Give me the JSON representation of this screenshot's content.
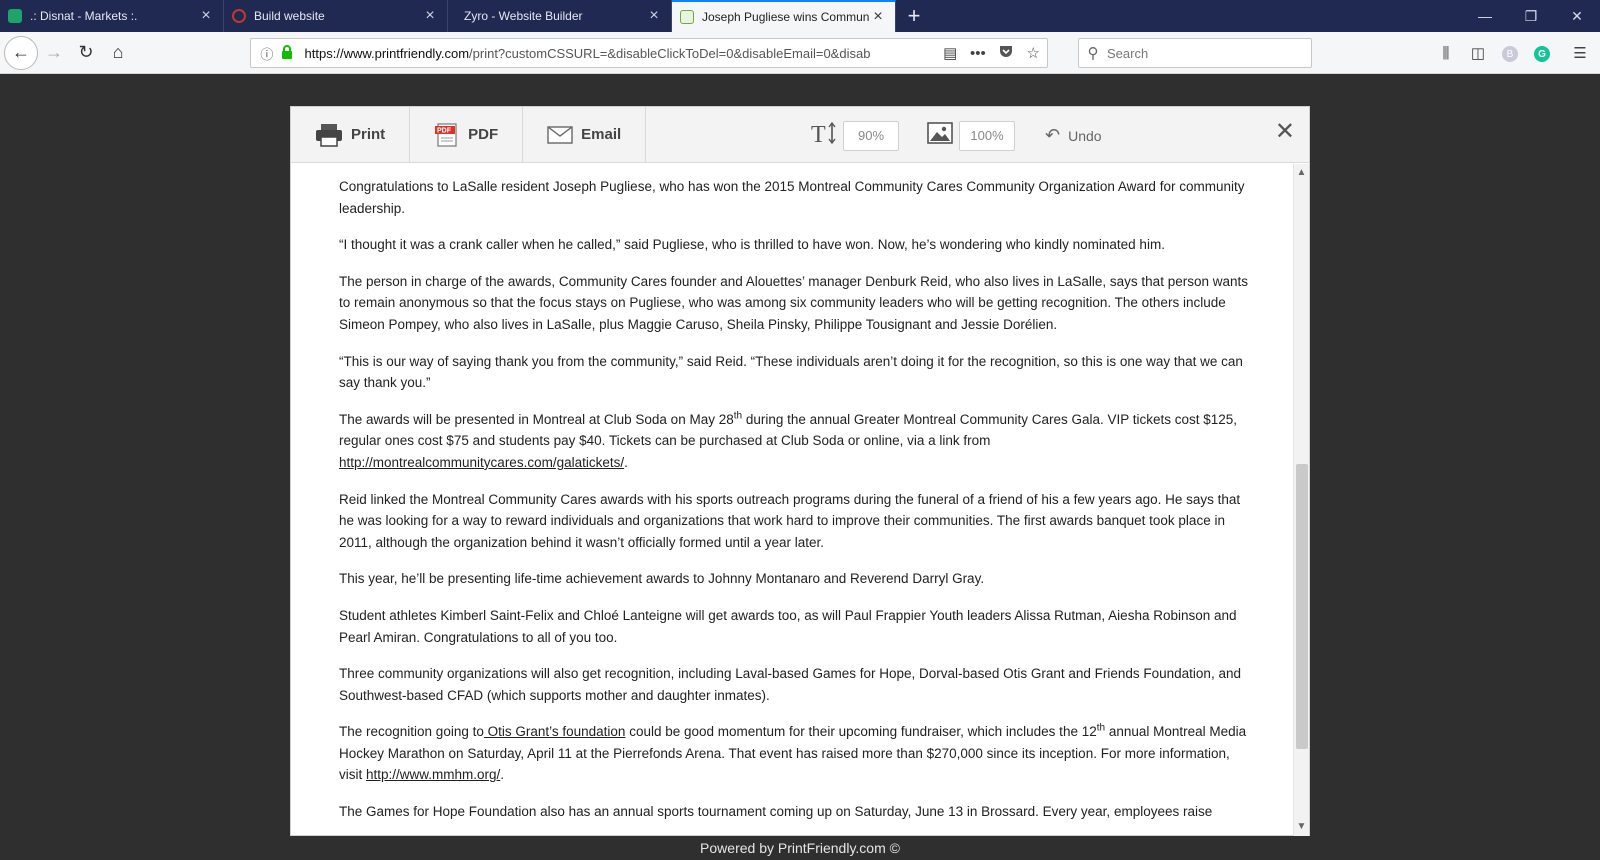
{
  "browser": {
    "tabs": [
      {
        "title": ".: Disnat - Markets :.",
        "favicon": "disnat-icon",
        "active": false
      },
      {
        "title": "Build website",
        "favicon": "zyro-icon",
        "active": false
      },
      {
        "title": "Zyro - Website Builder",
        "favicon": "blank-icon",
        "active": false
      },
      {
        "title": "Joseph Pugliese wins Commun",
        "favicon": "printfriendly-icon",
        "active": true
      }
    ],
    "new_tab_symbol": "+",
    "window_controls": [
      "—",
      "❐",
      "✕"
    ],
    "url_domain": "https://www.printfriendly.com",
    "url_rest": "/print?customCSSURL=&disableClickToDel=0&disableEmail=0&disab",
    "search_placeholder": "Search",
    "profile_letter": "B",
    "grammarly_letter": "G"
  },
  "toolbar": {
    "print_label": "Print",
    "pdf_label": "PDF",
    "email_label": "Email",
    "text_size": "90%",
    "image_size": "100%",
    "undo_label": "Undo",
    "close_symbol": "✕"
  },
  "article": {
    "p1": "Congratulations to LaSalle resident Joseph Pugliese, who has won the 2015 Montreal Community Cares Community Organization Award for community leadership.",
    "p2": "“I thought it was a crank caller when he called,” said Pugliese, who is thrilled to have won. Now, he’s wondering who kindly nominated him.",
    "p3": "The person in charge of the awards, Community Cares founder and Alouettes’ manager Denburk Reid, who also lives in LaSalle, says that person wants to remain anonymous so that the focus stays on Pugliese, who was among six community leaders who will be getting recognition. The others include Simeon Pompey, who also lives in LaSalle, plus Maggie Caruso, Sheila Pinsky, Philippe Tousignant and Jessie Dorélien.",
    "p4": "“This is our way of saying thank you from the community,” said Reid. “These individuals aren’t doing it for the recognition, so this is one way that we can say thank you.”",
    "p5_a": "The awards will be presented in Montreal at Club Soda on May 28",
    "p5_sup": "th",
    "p5_b": " during the annual Greater Montreal Community Cares Gala. VIP tickets cost $125, regular ones cost $75 and students pay $40. Tickets can be purchased at Club Soda or online, via a link from ",
    "p5_link": "http://montrealcommunitycares.com/galatickets/",
    "p5_c": ".",
    "p6": "Reid linked the Montreal Community Cares awards with his sports outreach programs during the funeral of a friend of his a few years ago. He says that he was looking for a way to reward individuals and organizations that work hard to improve their communities. The first awards banquet took place in 2011, although the organization behind it wasn’t officially formed until a year later.",
    "p7": "This year, he’ll be presenting life-time achievement awards to Johnny Montanaro and Reverend Darryl Gray.",
    "p8": "Student athletes Kimberl Saint-Felix and Chloé Lanteigne will get awards too, as will Paul Frappier Youth leaders Alissa Rutman, Aiesha Robinson and Pearl Amiran. Congratulations to all of you too.",
    "p9": "Three community organizations will also get recognition, including Laval-based Games for Hope, Dorval-based Otis Grant and Friends Foundation, and Southwest-based CFAD (which supports mother and daughter inmates).",
    "p10_a": "The recognition going to",
    "p10_link": " Otis Grant’s foundation",
    "p10_b": " could be good momentum for their upcoming fundraiser, which includes the 12",
    "p10_sup": "th",
    "p10_c": " annual Montreal Media Hockey Marathon on Saturday, April 11 at the Pierrefonds Arena. That event has raised more than $270,000 since its inception. For more information, visit ",
    "p10_link2": "http://www.mmhm.org/",
    "p10_d": ".",
    "p11": "The Games for Hope Foundation also has an annual sports tournament coming up on Saturday, June 13 in Brossard. Every year, employees raise"
  },
  "footer": {
    "text": "Powered by PrintFriendly.com ©"
  },
  "colors": {
    "tabstrip": "#1f2952",
    "page_bg": "#2f2f2f",
    "active_tab_accent": "#0a84ff",
    "grammarly": "#15c39a"
  }
}
